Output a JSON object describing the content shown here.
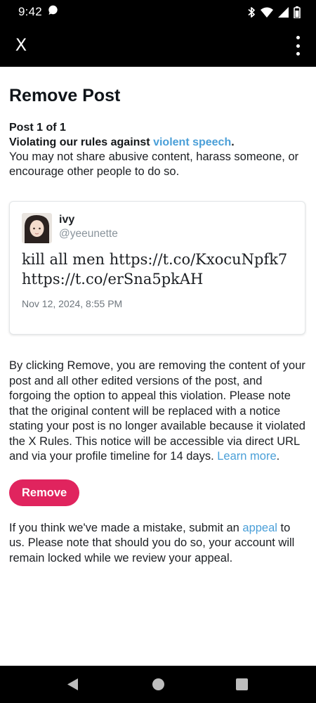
{
  "status_bar": {
    "time": "9:42",
    "icons": [
      "chat-bubble-icon",
      "bluetooth-icon",
      "wifi-icon",
      "signal-icon",
      "battery-icon"
    ]
  },
  "app_bar": {
    "close_label": "X",
    "more_icon": "more-vertical-icon"
  },
  "page": {
    "title": "Remove Post",
    "post_count": "Post 1 of 1",
    "violation_prefix": "Violating our rules against ",
    "violation_link": "violent speech",
    "violation_suffix": ".",
    "violation_description": "You may not share abusive content, harass someone, or encourage other people to do so."
  },
  "post": {
    "display_name": "ivy",
    "handle": "@yeeunette",
    "text": "kill all men https://t.co/KxocuNpfk7 https://t.co/erSna5pkAH",
    "timestamp": "Nov 12, 2024, 8:55 PM"
  },
  "remove_notice": {
    "text": "By clicking Remove, you are removing the content of your post and all other edited versions of the post, and forgoing the option to appeal this violation. Please note that the original content will be replaced with a notice stating your post is no longer available because it violated the X Rules. This notice will be accessible via direct URL and via your profile timeline for 14 days. ",
    "learn_more": "Learn more",
    "suffix": "."
  },
  "remove_button": {
    "label": "Remove"
  },
  "appeal_notice": {
    "prefix": "If you think we've made a mistake, submit an ",
    "link": "appeal",
    "suffix": " to us. Please note that should you do so, your account will remain locked while we review your appeal."
  },
  "colors": {
    "accent_link": "#4a9fd8",
    "remove_button": "#e0245e",
    "bars": "#000000"
  }
}
